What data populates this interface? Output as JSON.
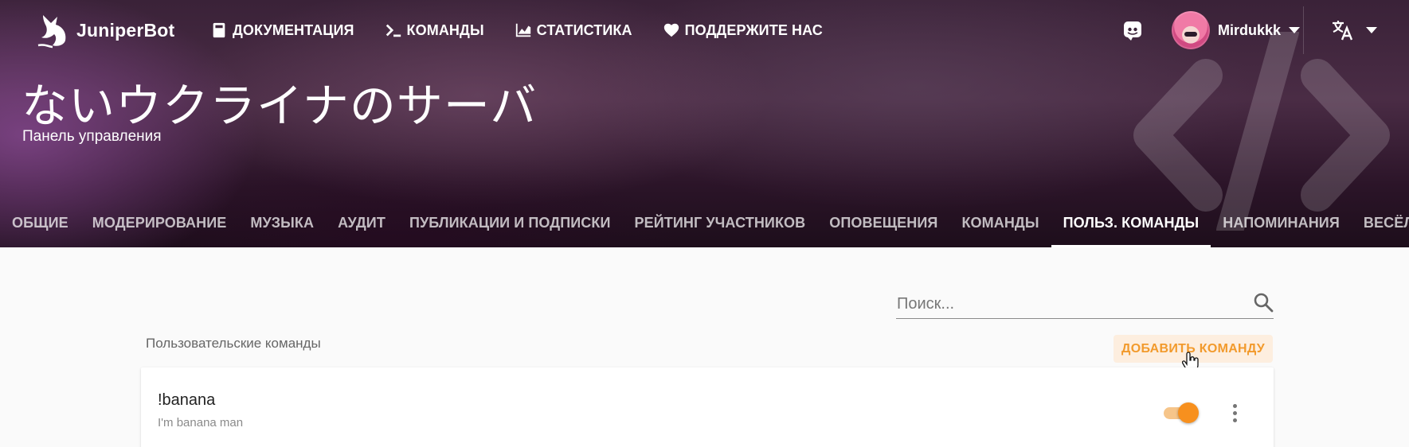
{
  "brand": {
    "name": "JuniperBot"
  },
  "nav": {
    "links": [
      {
        "label": "ДОКУМЕНТАЦИЯ",
        "icon": "book-icon"
      },
      {
        "label": "КОМАНДЫ",
        "icon": "terminal-icon"
      },
      {
        "label": "СТАТИСТИКА",
        "icon": "chart-icon"
      },
      {
        "label": "ПОДДЕРЖИТЕ НАС",
        "icon": "heart-icon"
      }
    ],
    "discord_icon": "discord-icon",
    "user": {
      "name": "Mirdukkk"
    },
    "language_icon": "translate-icon"
  },
  "hero": {
    "server_name": "ないウクライナのサーバ",
    "subtitle": "Панель управления"
  },
  "tabs": [
    {
      "label": "ОБЩИЕ",
      "active": false
    },
    {
      "label": "МОДЕРИРОВАНИЕ",
      "active": false
    },
    {
      "label": "МУЗЫКА",
      "active": false
    },
    {
      "label": "АУДИТ",
      "active": false
    },
    {
      "label": "ПУБЛИКАЦИИ И ПОДПИСКИ",
      "active": false
    },
    {
      "label": "РЕЙТИНГ УЧАСТНИКОВ",
      "active": false
    },
    {
      "label": "ОПОВЕЩЕНИЯ",
      "active": false
    },
    {
      "label": "КОМАНДЫ",
      "active": false
    },
    {
      "label": "ПОЛЬЗ. КОМАНДЫ",
      "active": true
    },
    {
      "label": "НАПОМИНАНИЯ",
      "active": false
    },
    {
      "label": "ВЕСЁЛОСТИ",
      "active": false
    }
  ],
  "search": {
    "placeholder": "Поиск...",
    "value": ""
  },
  "section": {
    "title": "Пользовательские команды",
    "add_label": "ДОБАВИТЬ КОМАНДУ"
  },
  "commands": [
    {
      "name": "!banana",
      "description": "I'm banana man",
      "enabled": true
    }
  ],
  "colors": {
    "accent": "#f7901e",
    "accent_light": "#fdeedf",
    "page_bg": "#fafafa"
  }
}
